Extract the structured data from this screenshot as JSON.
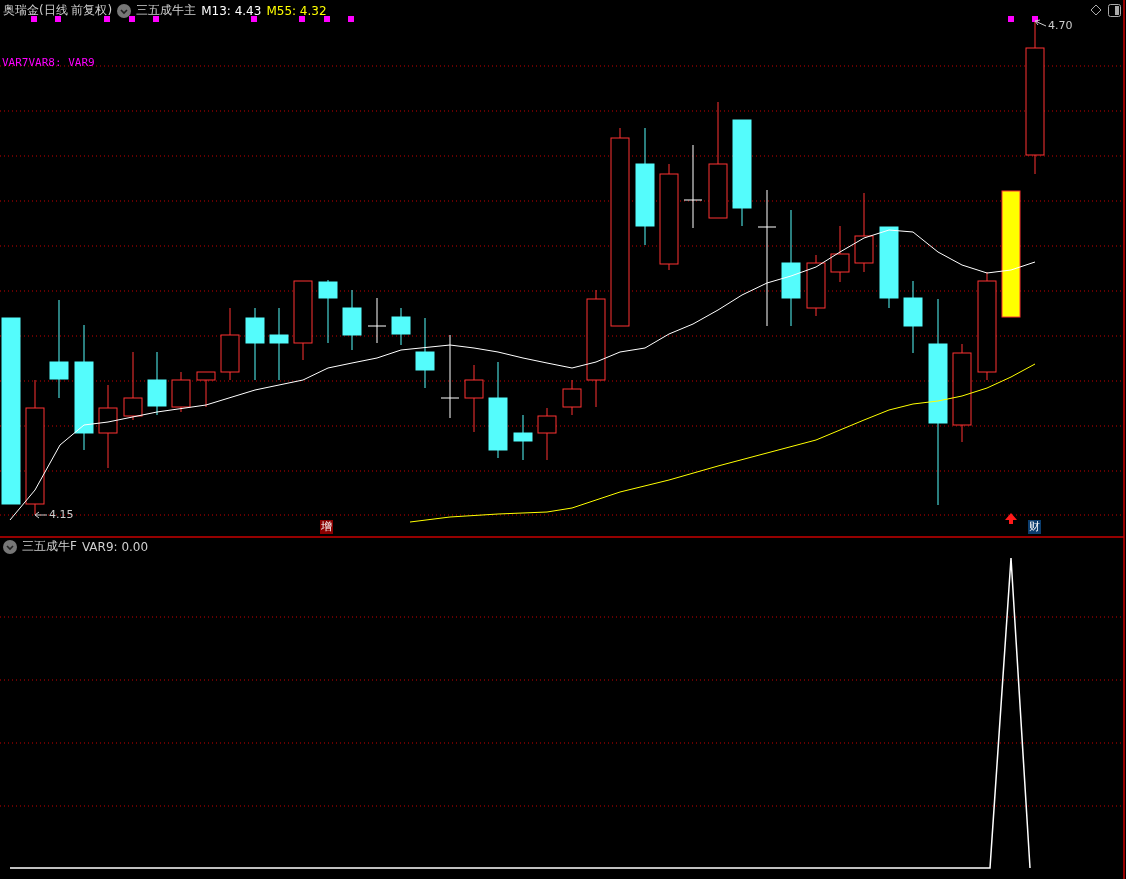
{
  "main_panel": {
    "title": "奥瑞金(日线 前复权)",
    "indicator": "三五成牛主",
    "m13": "M13: 4.43",
    "m55": "M55: 4.32",
    "var_label": "VAR7VAR8: VAR9",
    "high_label": "4.70",
    "low_label": "4.15",
    "markers": [
      {
        "kind": "zeng",
        "text": "增"
      },
      {
        "kind": "cai",
        "text": "财"
      }
    ]
  },
  "sub_panel": {
    "indicator": "三五成牛F",
    "value": "VAR9: 0.00"
  }
}
